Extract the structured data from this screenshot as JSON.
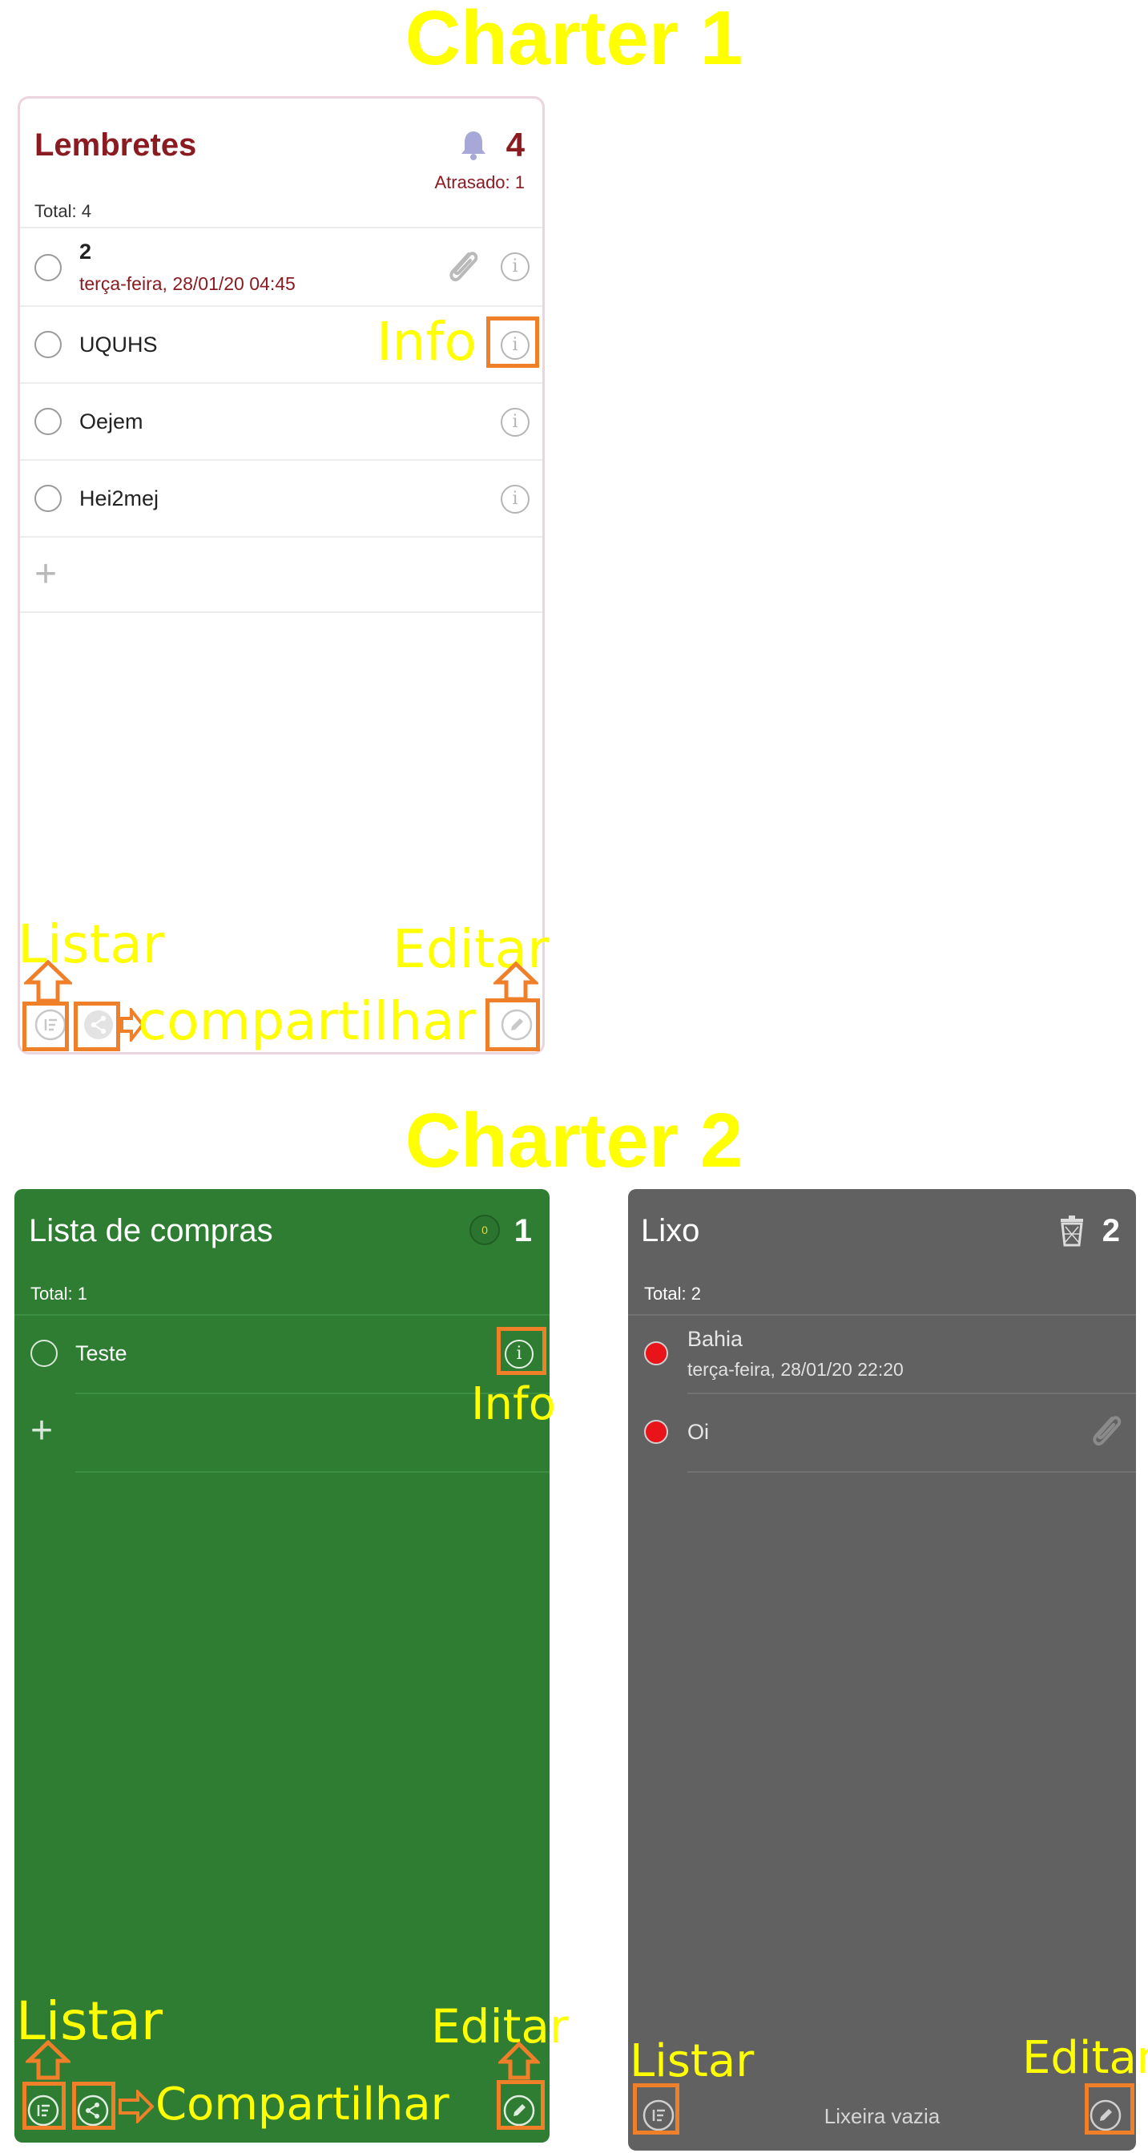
{
  "sections": {
    "charter1_title": "Charter 1",
    "charter2_title": "Charter 2"
  },
  "colors": {
    "annotation": "#ffff00",
    "highlight_box": "#f07f2a",
    "reminders_accent": "#8a1c21",
    "shopping_bg": "#2e7d32",
    "trash_bg": "#616161"
  },
  "reminders": {
    "title": "Lembretes",
    "count": "4",
    "icon": "bell-icon",
    "overdue": "Atrasado: 1",
    "total": "Total: 4",
    "items": [
      {
        "title": "2",
        "subtitle": "terça-feira, 28/01/20 04:45",
        "attachment": true
      },
      {
        "title": "UQUHS"
      },
      {
        "title": "Oejem"
      },
      {
        "title": "Hei2mej"
      }
    ],
    "add": "+"
  },
  "shopping": {
    "title": "Lista de compras",
    "badge": "0",
    "count": "1",
    "total": "Total: 1",
    "items": [
      {
        "title": "Teste"
      }
    ],
    "add": "+"
  },
  "trash": {
    "title": "Lixo",
    "count": "2",
    "icon": "trash-icon",
    "total": "Total: 2",
    "items": [
      {
        "title": "Bahia",
        "subtitle": "terça-feira, 28/01/20 22:20"
      },
      {
        "title": "Oi",
        "attachment": true
      }
    ],
    "empty_label": "Lixeira vazia"
  },
  "annotations": {
    "info": "Info",
    "listar": "Listar",
    "editar": "Editar",
    "compartilhar_lower": "compartilhar",
    "compartilhar_upper": "Compartilhar"
  }
}
